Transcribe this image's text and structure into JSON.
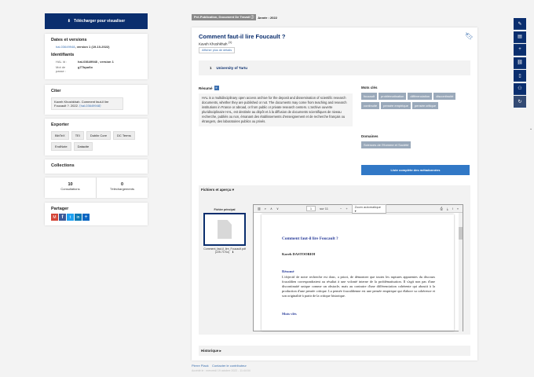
{
  "left": {
    "download_label": "Télécharger pour visualiser",
    "dates_title": "Dates et versions",
    "version_id": "hal-03649948",
    "version_text": ", version 1 (19-10-2022)",
    "identifiers_title": "Identifiants",
    "hal_id_label": "HAL Id :",
    "hal_id_value": "hal-03649948 , version 1",
    "pass_label": "Mot de passe :",
    "pass_value": "g77bpu6o",
    "cite_title": "Citer",
    "cite_text": "Kaveh Khoshkhah. Comment faut-il lire Foucault ?. 2022.",
    "cite_link": "⟨hal-03649948⟩",
    "export_title": "Exporter",
    "exports": [
      "BibTeX",
      "TEI",
      "Dublin Core",
      "DC Terms",
      "EndNote",
      "Datacite"
    ],
    "collections_title": "Collections",
    "consult_count": "10",
    "consult_label": "Consultations",
    "dl_count": "0",
    "dl_label": "Téléchargements",
    "share_title": "Partager"
  },
  "main": {
    "badge": "Pré-Publication, Document De Travail",
    "year": "Année : 2022",
    "title": "Comment faut-il lire Foucault ?",
    "author": "Kaveh Khoshkhah",
    "author_sup": "(1)",
    "details_btn": "Afficher plus de détails",
    "affil_num": "1",
    "affil": "University of Tartu",
    "resume_label": "Résumé",
    "lang": "fr",
    "abstract": "HAL is a multidisciplinary open access archive for the deposit and dissemination of scientific research documents, whether they are published or not. The documents may come from teaching and research institutions in France or abroad, or from public or private research centers. L'archive ouverte pluridisciplinaire HAL, est destinée au dépôt et à la diffusion de documents scientifiques de niveau recherche, publiés ou non, émanant des établissements d'enseignement et de recherche français ou étrangers, des laboratoires publics ou privés.",
    "keywords_title": "Mots clés",
    "keywords": [
      "foucault",
      "problématisation",
      "différenciation",
      "discontinuité",
      "continuité",
      "pensée empirique",
      "pensée critique"
    ],
    "domains_title": "Domaines",
    "domain": "Sciences de l'Homme et Société",
    "list_btn": "Liste complète des métadonnées",
    "files_title": "Fichiers et aperçu",
    "main_file_label": "Fichier principal",
    "file_name": "Comment_faut-il_lire_Foucault.pdf",
    "file_size": "(225.73 Ko)",
    "page_num": "1",
    "page_total": "sur 11",
    "zoom": "Zoom automatique",
    "pdf_title": "Comment faut-il lire Foucault ?",
    "pdf_author": "Kaveh DASTOOREH",
    "pdf_resume": "Résumé",
    "pdf_body": "L'objectif de notre recherche est donc, a priori, de démontrer que toutes les ruptures apparentes du discours foucaldien correspondraient au résultat à une volonté interne de la problématisation. Il s'agit non pas d'une discontinuité unique comme un obstacle, mais au contraire d'une différenciation cohérente qui aboutit à la production d'une pensée critique. La pensée foucaldienne est une pensée empirique qui élabore sa cohérence et son originalité à partir de la critique historique.",
    "pdf_keywords": "Mots-clés",
    "history": "Historique",
    "footer_link1": "Pierre Plack",
    "footer_link2": "Contacter le contributeur",
    "footer_small": "Accédé le : mercredi 19 octobre 2022 - 11:44:04"
  },
  "sidebar_icons": [
    "pencil-icon",
    "add-file-icon",
    "plus-icon",
    "link-icon",
    "document-icon",
    "user-add-icon",
    "refresh-icon"
  ]
}
